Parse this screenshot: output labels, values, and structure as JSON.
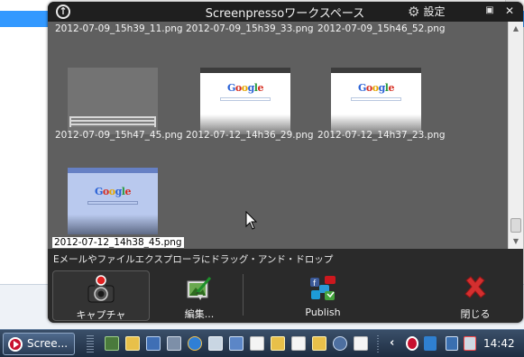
{
  "workspace": {
    "title": "Screenpressoワークスペース",
    "settings_label": "設定",
    "hint": "Eメールやファイルエクスプローラにドラッグ・アンド・ドロップ",
    "items": [
      {
        "name": "2012-07-09_15h39_11.png"
      },
      {
        "name": "2012-07-09_15h39_33.png"
      },
      {
        "name": "2012-07-09_15h46_52.png"
      },
      {
        "name": "2012-07-09_15h47_45.png"
      },
      {
        "name": "2012-07-12_14h36_29.png"
      },
      {
        "name": "2012-07-12_14h37_23.png"
      },
      {
        "name": "2012-07-12_14h38_45.png"
      }
    ],
    "actions": {
      "capture": "キャプチャ",
      "edit": "編集...",
      "publish": "Publish",
      "close": "閉じる"
    },
    "thumb_logo": "Google"
  },
  "taskbar": {
    "app_button": "Scree...",
    "clock": "14:42"
  },
  "colors": {
    "workspace_bg": "#5f5f5f",
    "selection_bg": "#3399ff",
    "close_icon": "#d32f2f"
  }
}
